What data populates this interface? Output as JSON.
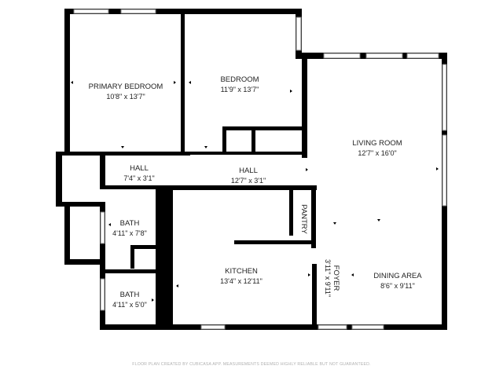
{
  "rooms": {
    "primary_bedroom": {
      "name": "PRIMARY BEDROOM",
      "dims": "10'8\" x 13'7\""
    },
    "bedroom": {
      "name": "BEDROOM",
      "dims": "11'9\" x 13'7\""
    },
    "living_room": {
      "name": "LIVING ROOM",
      "dims": "12'7\" x 16'0\""
    },
    "hall_left": {
      "name": "HALL",
      "dims": "7'4\" x 3'1\""
    },
    "hall_center": {
      "name": "HALL",
      "dims": "12'7\" x 3'1\""
    },
    "pantry": {
      "name": "PANTRY"
    },
    "bath_upper": {
      "name": "BATH",
      "dims": "4'11\" x 7'8\""
    },
    "bath_lower": {
      "name": "BATH",
      "dims": "4'11\" x 5'0\""
    },
    "kitchen": {
      "name": "KITCHEN",
      "dims": "13'4\" x 12'11\""
    },
    "foyer": {
      "name": "FOYER",
      "dims": "3'11\" x 9'11\""
    },
    "dining_area": {
      "name": "DINING AREA",
      "dims": "8'6\" x 9'11\""
    }
  },
  "footer_note": "FLOOR PLAN CREATED BY CUBICASA APP. MEASUREMENTS DEEMED HIGHLY RELIABLE BUT NOT GUARANTEED."
}
